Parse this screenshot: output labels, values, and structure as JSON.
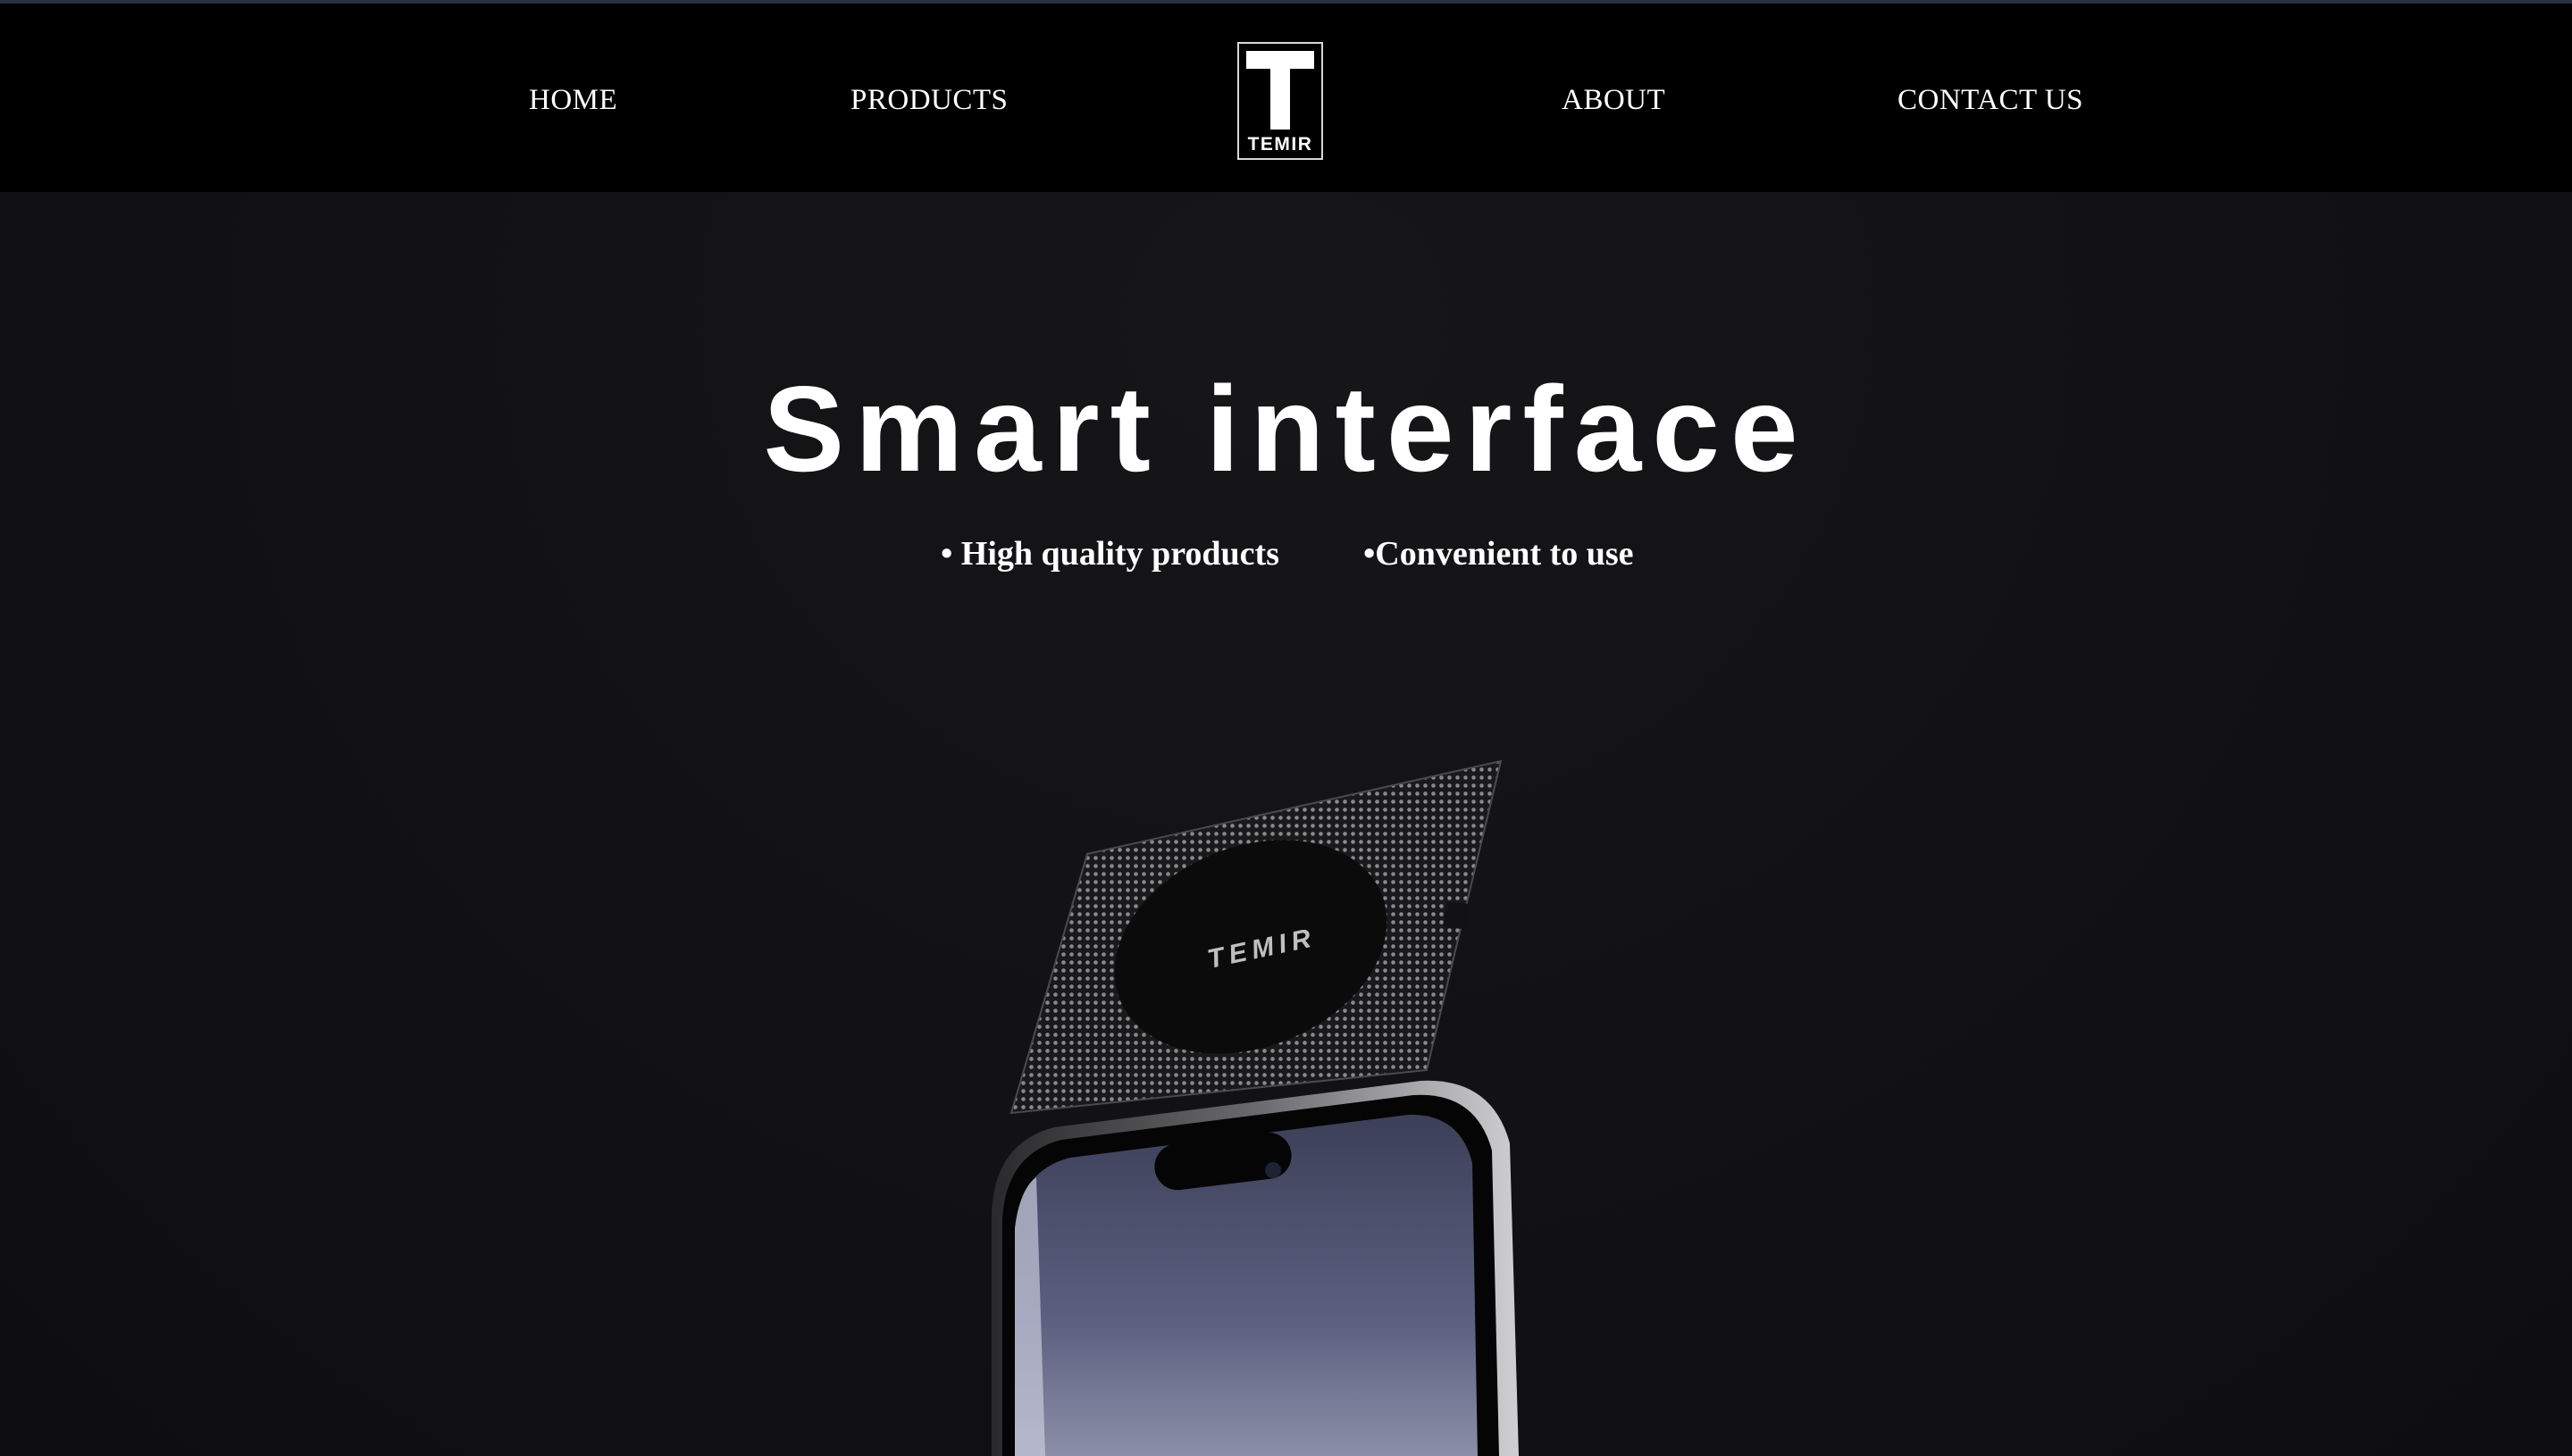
{
  "nav": {
    "home": "HOME",
    "products": "PRODUCTS",
    "about": "ABOUT",
    "contact": "CONTACT US",
    "logo_text": "TEMIR"
  },
  "hero": {
    "title": "Smart interface",
    "features": [
      "• High quality products",
      "•Convenient to use"
    ],
    "card_label": "TEMIR"
  },
  "colors": {
    "nav_background": "#000000",
    "page_background": "#121214",
    "text": "#ffffff"
  }
}
